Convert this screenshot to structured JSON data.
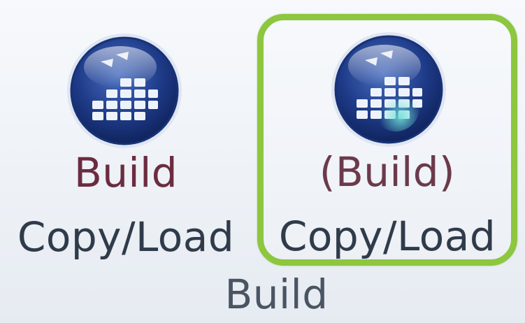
{
  "ribbon": {
    "group_label": "Build",
    "buttons": [
      {
        "line1": "Build",
        "line2": "Copy/Load",
        "icon": "build-blocks-icon"
      },
      {
        "line1": "(Build)",
        "line2": "Copy/Load",
        "icon": "build-blocks-icon",
        "highlighted": true
      }
    ],
    "highlight_color": "#8dc63f"
  }
}
